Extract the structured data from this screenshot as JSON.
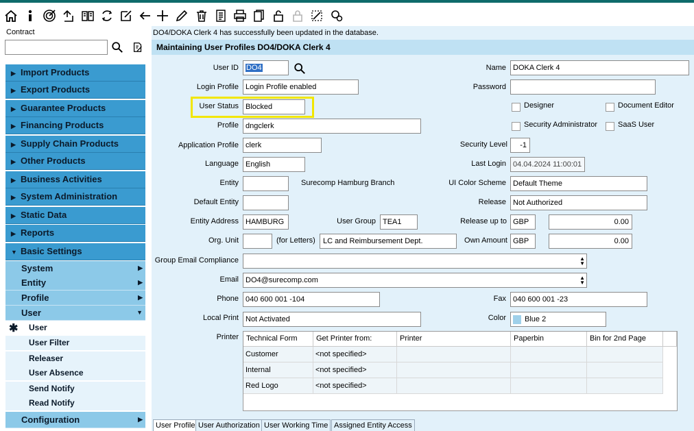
{
  "toolbar": {
    "icons": [
      "home-icon",
      "info-icon",
      "target-icon",
      "upload-icon",
      "book-icon",
      "refresh-cycle-icon",
      "edit-note-icon",
      "back-icon",
      "add-icon",
      "pencil-icon",
      "trash-icon",
      "form-icon",
      "print-icon",
      "copy-icon",
      "lock-icon",
      "lock-disabled-icon",
      "edit-dotted-icon",
      "settings-search-icon"
    ]
  },
  "sidebar": {
    "contract_label": "Contract",
    "contract_value": "",
    "top_menu": [
      {
        "label": "Import Products",
        "arrow": "▶"
      },
      {
        "label": "Export Products",
        "arrow": "▶"
      },
      {
        "label": "Guarantee Products",
        "arrow": "▶"
      },
      {
        "label": "Financing Products",
        "arrow": "▶"
      },
      {
        "label": "Supply Chain Products",
        "arrow": "▶"
      },
      {
        "label": "Other Products",
        "arrow": "▶"
      },
      {
        "label": "Business Activities",
        "arrow": "▶"
      },
      {
        "label": "System Administration",
        "arrow": "▶"
      },
      {
        "label": "Static Data",
        "arrow": "▶"
      },
      {
        "label": "Reports",
        "arrow": "▶"
      },
      {
        "label": "Basic Settings",
        "arrow": "▼"
      }
    ],
    "sub_menu": [
      {
        "label": "System",
        "arrow": "▶"
      },
      {
        "label": "Entity",
        "arrow": "▶"
      },
      {
        "label": "Profile",
        "arrow": "▶"
      },
      {
        "label": "User",
        "arrow": "▼"
      }
    ],
    "leaf_menu": [
      {
        "label": "User",
        "star": "✱"
      },
      {
        "label": "User Filter"
      },
      {
        "label": "Releaser"
      },
      {
        "label": "User Absence"
      },
      {
        "label": "Send Notify"
      },
      {
        "label": "Read Notify"
      }
    ],
    "config": {
      "label": "Configuration",
      "arrow": "▶"
    }
  },
  "main": {
    "message": "DO4/DOKA Clerk 4 has successfully been updated in the database.",
    "title": "Maintaining User Profiles DO4/DOKA Clerk 4",
    "user_id_label": "User ID",
    "user_id": "DO4",
    "name_label": "Name",
    "name": "DOKA Clerk 4",
    "login_profile_label": "Login Profile",
    "login_profile": "Login Profile enabled",
    "password_label": "Password",
    "password": "",
    "user_status_label": "User Status",
    "user_status": "Blocked",
    "designer_label": "Designer",
    "document_editor_label": "Document Editor",
    "profile_label": "Profile",
    "profile": "dngclerk",
    "security_admin_label": "Security Administrator",
    "saas_user_label": "SaaS User",
    "app_profile_label": "Application Profile",
    "app_profile": "clerk",
    "security_level_label": "Security Level",
    "security_level": "-1",
    "language_label": "Language",
    "language": "English",
    "last_login_label": "Last Login",
    "last_login": "04.04.2024 11:00:01",
    "entity_label": "Entity",
    "entity": "",
    "entity_name": "Surecomp Hamburg Branch",
    "ui_color_label": "UI Color Scheme",
    "ui_color": "Default Theme",
    "default_entity_label": "Default Entity",
    "default_entity": "",
    "release_label": "Release",
    "release": "Not Authorized",
    "entity_address_label": "Entity Address",
    "entity_address": "HAMBURG",
    "user_group_label": "User Group",
    "user_group": "TEA1",
    "release_up_to_label": "Release up to",
    "release_ccy": "GBP",
    "release_amount": "0.00",
    "org_unit_label": "Org. Unit",
    "org_unit": "",
    "for_letters_label": "(for Letters)",
    "org_unit_name": "LC and Reimbursement Dept.",
    "own_amount_label": "Own Amount",
    "own_ccy": "GBP",
    "own_amount": "0.00",
    "group_email_label": "Group Email Compliance",
    "group_email": "",
    "email_label": "Email",
    "email": "DO4@surecomp.com",
    "phone_label": "Phone",
    "phone": "040 600 001 -104",
    "fax_label": "Fax",
    "fax": "040 600 001 -23",
    "local_print_label": "Local Print",
    "local_print": "Not Activated",
    "color_label": "Color",
    "color": "Blue 2",
    "color_swatch": "#9fd0ea",
    "printer_label": "Printer"
  },
  "printer_table": {
    "headers": [
      "Technical Form",
      "Get Printer from:",
      "Printer",
      "Paperbin",
      "Bin for 2nd Page"
    ],
    "rows": [
      [
        "Customer",
        "<not specified>",
        "",
        "",
        ""
      ],
      [
        "Internal",
        "<not specified>",
        "",
        "",
        ""
      ],
      [
        "Red Logo",
        "<not specified>",
        "",
        "",
        ""
      ]
    ]
  },
  "tabs": [
    "User Profile",
    "User Authorization",
    "User Working Time",
    "Assigned Entity Access"
  ]
}
